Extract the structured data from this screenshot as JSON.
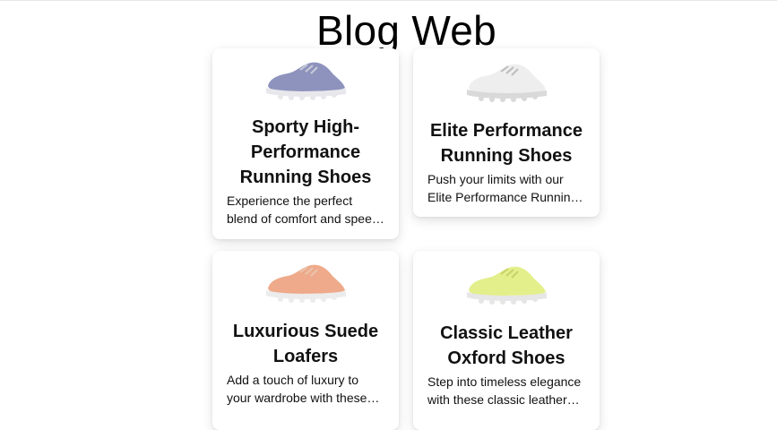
{
  "header": {
    "title": "Blog Web"
  },
  "posts": [
    {
      "title": "Sporty High-Performance Running Shoes",
      "excerpt": "Experience the perfect blend of comfort and speed with our sporty high-performance running shoes.",
      "image_icon": "shoe-image-lavender",
      "colors": {
        "upper": "#8e93bd",
        "sole": "#e8e8ec",
        "accent": "#c9ccd9"
      }
    },
    {
      "title": "Elite Performance Running Shoes",
      "excerpt": "Push your limits with our Elite Performance Running Shoes designed for serious runners.",
      "image_icon": "shoe-image-white",
      "colors": {
        "upper": "#eeeeee",
        "sole": "#d9d9d9",
        "accent": "#bcbcbc"
      }
    },
    {
      "title": "Luxurious Suede Loafers",
      "excerpt": "Add a touch of luxury to your wardrobe with these luxurious suede loafers.",
      "image_icon": "shoe-image-peach",
      "colors": {
        "upper": "#eeaa8a",
        "sole": "#ececec",
        "accent": "#e9c4b0"
      }
    },
    {
      "title": "Classic Leather Oxford Shoes",
      "excerpt": "Step into timeless elegance with these classic leather oxford shoes.",
      "image_icon": "shoe-image-lime",
      "colors": {
        "upper": "#e3ef8a",
        "sole": "#e6e6e6",
        "accent": "#c9d26a"
      }
    }
  ]
}
